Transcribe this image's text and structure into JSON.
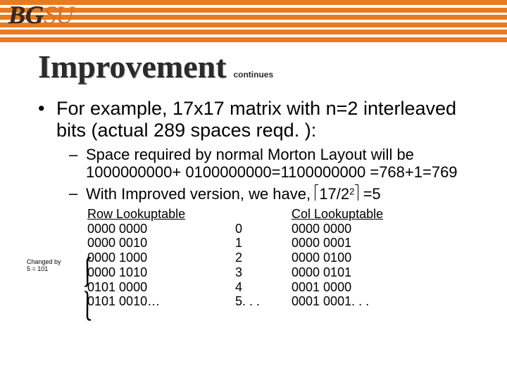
{
  "logo": {
    "bold": "BG",
    "light": "SU"
  },
  "title": "Improvement",
  "subtitle": "continues",
  "bullet_main": "For example, 17x17 matrix with n=2 interleaved bits (actual 289 spaces reqd. ):",
  "sub1_a": "Space required by normal Morton Layout will be 1000000000+ 0100000000=1100000000 =768+1=769",
  "sub2_a": "With Improved version, we have,",
  "sub2_ceil_expr": "17/2",
  "sub2_sup": "2",
  "sub2_tail": "=5",
  "row_head": "Row Lookuptable",
  "col_head": "Col Lookuptable",
  "idx": [
    "0",
    "1",
    "2",
    "3",
    "4",
    "5. . ."
  ],
  "row_vals": [
    "0000 0000",
    "0000 0010",
    "0000 1000",
    "0000 1010",
    "0101 0000",
    "0101 0010…"
  ],
  "col_vals": [
    "0000 0000",
    "0000 0001",
    "0000 0100",
    "0000 0101",
    "0001 0000",
    "0001 0001. . ."
  ],
  "changed_by": "Changed by",
  "changed_by2": "5 = 101"
}
